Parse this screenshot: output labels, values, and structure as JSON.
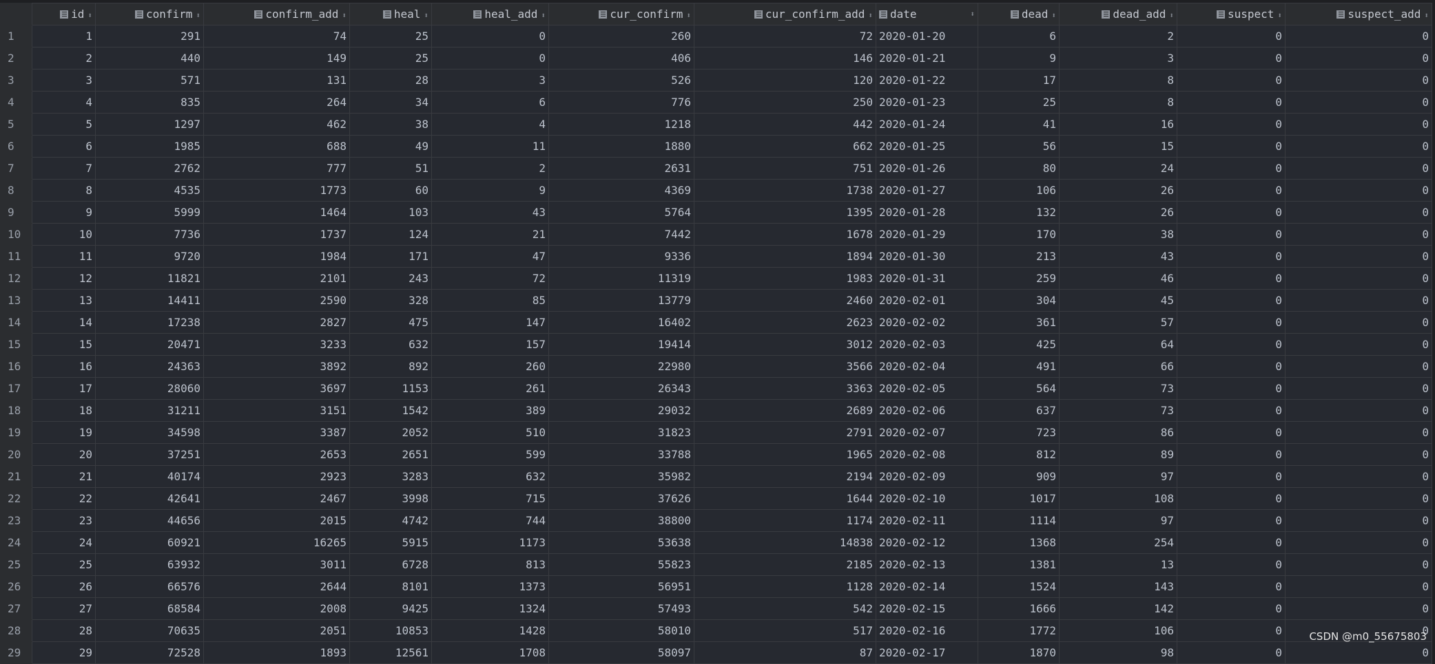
{
  "columns": [
    "id",
    "confirm",
    "confirm_add",
    "heal",
    "heal_add",
    "cur_confirm",
    "cur_confirm_add",
    "date",
    "dead",
    "dead_add",
    "suspect",
    "suspect_add"
  ],
  "sort_icon": "sort-arrows-icon",
  "rows": [
    [
      "1",
      "291",
      "74",
      "25",
      "0",
      "260",
      "72",
      "2020-01-20",
      "6",
      "2",
      "0",
      "0"
    ],
    [
      "2",
      "440",
      "149",
      "25",
      "0",
      "406",
      "146",
      "2020-01-21",
      "9",
      "3",
      "0",
      "0"
    ],
    [
      "3",
      "571",
      "131",
      "28",
      "3",
      "526",
      "120",
      "2020-01-22",
      "17",
      "8",
      "0",
      "0"
    ],
    [
      "4",
      "835",
      "264",
      "34",
      "6",
      "776",
      "250",
      "2020-01-23",
      "25",
      "8",
      "0",
      "0"
    ],
    [
      "5",
      "1297",
      "462",
      "38",
      "4",
      "1218",
      "442",
      "2020-01-24",
      "41",
      "16",
      "0",
      "0"
    ],
    [
      "6",
      "1985",
      "688",
      "49",
      "11",
      "1880",
      "662",
      "2020-01-25",
      "56",
      "15",
      "0",
      "0"
    ],
    [
      "7",
      "2762",
      "777",
      "51",
      "2",
      "2631",
      "751",
      "2020-01-26",
      "80",
      "24",
      "0",
      "0"
    ],
    [
      "8",
      "4535",
      "1773",
      "60",
      "9",
      "4369",
      "1738",
      "2020-01-27",
      "106",
      "26",
      "0",
      "0"
    ],
    [
      "9",
      "5999",
      "1464",
      "103",
      "43",
      "5764",
      "1395",
      "2020-01-28",
      "132",
      "26",
      "0",
      "0"
    ],
    [
      "10",
      "7736",
      "1737",
      "124",
      "21",
      "7442",
      "1678",
      "2020-01-29",
      "170",
      "38",
      "0",
      "0"
    ],
    [
      "11",
      "9720",
      "1984",
      "171",
      "47",
      "9336",
      "1894",
      "2020-01-30",
      "213",
      "43",
      "0",
      "0"
    ],
    [
      "12",
      "11821",
      "2101",
      "243",
      "72",
      "11319",
      "1983",
      "2020-01-31",
      "259",
      "46",
      "0",
      "0"
    ],
    [
      "13",
      "14411",
      "2590",
      "328",
      "85",
      "13779",
      "2460",
      "2020-02-01",
      "304",
      "45",
      "0",
      "0"
    ],
    [
      "14",
      "17238",
      "2827",
      "475",
      "147",
      "16402",
      "2623",
      "2020-02-02",
      "361",
      "57",
      "0",
      "0"
    ],
    [
      "15",
      "20471",
      "3233",
      "632",
      "157",
      "19414",
      "3012",
      "2020-02-03",
      "425",
      "64",
      "0",
      "0"
    ],
    [
      "16",
      "24363",
      "3892",
      "892",
      "260",
      "22980",
      "3566",
      "2020-02-04",
      "491",
      "66",
      "0",
      "0"
    ],
    [
      "17",
      "28060",
      "3697",
      "1153",
      "261",
      "26343",
      "3363",
      "2020-02-05",
      "564",
      "73",
      "0",
      "0"
    ],
    [
      "18",
      "31211",
      "3151",
      "1542",
      "389",
      "29032",
      "2689",
      "2020-02-06",
      "637",
      "73",
      "0",
      "0"
    ],
    [
      "19",
      "34598",
      "3387",
      "2052",
      "510",
      "31823",
      "2791",
      "2020-02-07",
      "723",
      "86",
      "0",
      "0"
    ],
    [
      "20",
      "37251",
      "2653",
      "2651",
      "599",
      "33788",
      "1965",
      "2020-02-08",
      "812",
      "89",
      "0",
      "0"
    ],
    [
      "21",
      "40174",
      "2923",
      "3283",
      "632",
      "35982",
      "2194",
      "2020-02-09",
      "909",
      "97",
      "0",
      "0"
    ],
    [
      "22",
      "42641",
      "2467",
      "3998",
      "715",
      "37626",
      "1644",
      "2020-02-10",
      "1017",
      "108",
      "0",
      "0"
    ],
    [
      "23",
      "44656",
      "2015",
      "4742",
      "744",
      "38800",
      "1174",
      "2020-02-11",
      "1114",
      "97",
      "0",
      "0"
    ],
    [
      "24",
      "60921",
      "16265",
      "5915",
      "1173",
      "53638",
      "14838",
      "2020-02-12",
      "1368",
      "254",
      "0",
      "0"
    ],
    [
      "25",
      "63932",
      "3011",
      "6728",
      "813",
      "55823",
      "2185",
      "2020-02-13",
      "1381",
      "13",
      "0",
      "0"
    ],
    [
      "26",
      "66576",
      "2644",
      "8101",
      "1373",
      "56951",
      "1128",
      "2020-02-14",
      "1524",
      "143",
      "0",
      "0"
    ],
    [
      "27",
      "68584",
      "2008",
      "9425",
      "1324",
      "57493",
      "542",
      "2020-02-15",
      "1666",
      "142",
      "0",
      "0"
    ],
    [
      "28",
      "70635",
      "2051",
      "10853",
      "1428",
      "58010",
      "517",
      "2020-02-16",
      "1772",
      "106",
      "0",
      "0"
    ],
    [
      "29",
      "72528",
      "1893",
      "12561",
      "1708",
      "58097",
      "87",
      "2020-02-17",
      "1870",
      "98",
      "0",
      "0"
    ]
  ],
  "watermark": "CSDN @m0_55675803"
}
